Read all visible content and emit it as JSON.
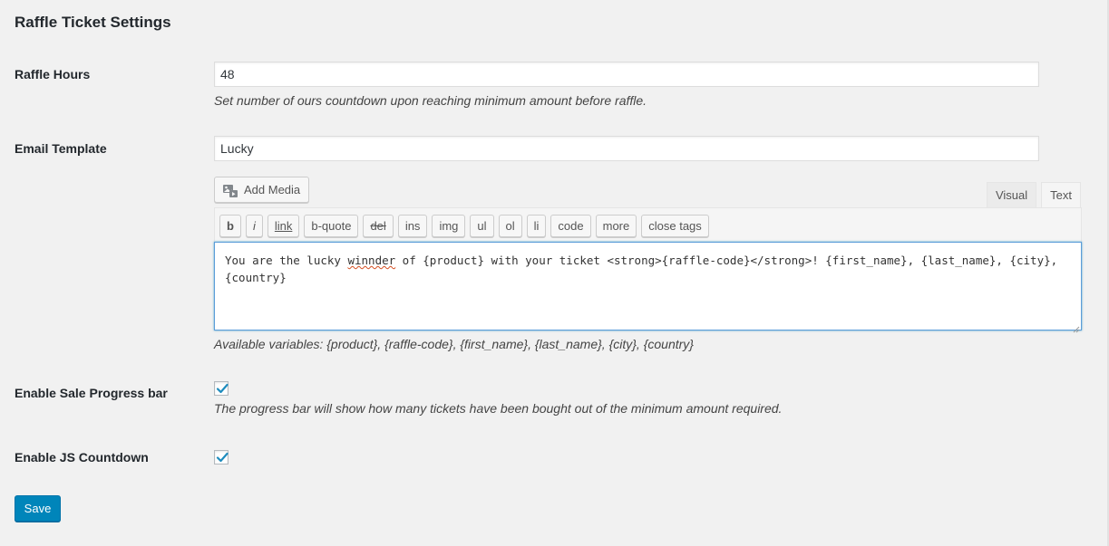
{
  "page": {
    "title": "Raffle Ticket Settings"
  },
  "raffle_hours": {
    "label": "Raffle Hours",
    "value": "48",
    "description": "Set number of ours countdown upon reaching minimum amount before raffle."
  },
  "email_template": {
    "label": "Email Template",
    "subject_value": "Lucky",
    "add_media_label": "Add Media",
    "tabs": {
      "visual": "Visual",
      "text": "Text",
      "active": "text"
    },
    "quicktags": {
      "b": "b",
      "i": "i",
      "link": "link",
      "bquote": "b-quote",
      "del": "del",
      "ins": "ins",
      "img": "img",
      "ul": "ul",
      "ol": "ol",
      "li": "li",
      "code": "code",
      "more": "more",
      "close_tags": "close tags"
    },
    "body_before": "You are the lucky ",
    "body_misspelled": "winnder",
    "body_after": " of {product} with your ticket <strong>{raffle-code}</strong>! {first_name}, {last_name}, {city},\n{country}",
    "description": "Available variables: {product}, {raffle-code}, {first_name}, {last_name}, {city}, {country}"
  },
  "sale_progress": {
    "label": "Enable Sale Progress bar",
    "checked": true,
    "description": "The progress bar will show how many tickets have been bought out of the minimum amount required."
  },
  "js_countdown": {
    "label": "Enable JS Countdown",
    "checked": true
  },
  "save_label": "Save",
  "colors": {
    "primary": "#0085ba",
    "check": "#1e8cbe",
    "background": "#f1f1f1"
  }
}
